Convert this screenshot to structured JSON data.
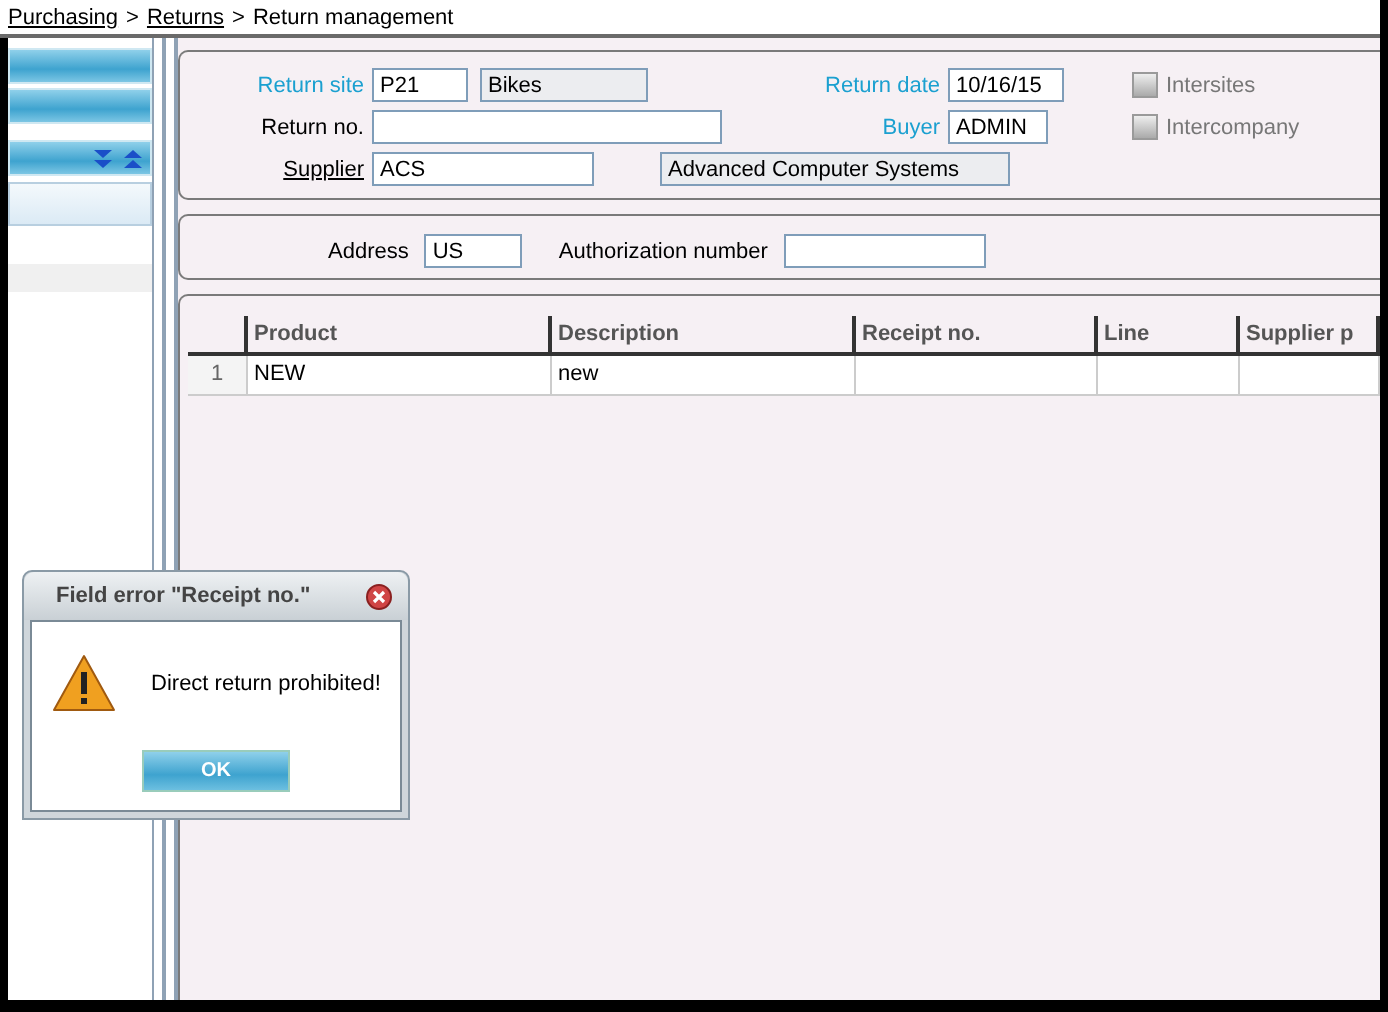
{
  "breadcrumb": [
    {
      "kind": "link",
      "text": "Purchasing"
    },
    {
      "kind": "separator",
      "text": ">"
    },
    {
      "kind": "link",
      "text": "Returns"
    },
    {
      "kind": "separator",
      "text": ">"
    },
    {
      "kind": "current",
      "text": "Return management"
    }
  ],
  "sidebar": {
    "bars": [
      {
        "kind": "plain"
      },
      {
        "kind": "plain"
      },
      {
        "kind": "tools"
      }
    ],
    "items": [
      {
        "selected": true
      },
      {
        "selected": false
      }
    ]
  },
  "header": {
    "rows": [
      {
        "label": {
          "text": "Return site",
          "kind": "required"
        },
        "fields": [
          {
            "value": "P21",
            "readonly": false
          },
          {
            "value": "Bikes",
            "readonly": true
          }
        ],
        "right": {
          "label": {
            "text": "Return date",
            "kind": "required"
          },
          "field": {
            "value": "10/16/15",
            "readonly": false
          }
        },
        "checkbox": {
          "label": "Intersites",
          "checked": false,
          "disabled": true
        }
      },
      {
        "label": {
          "text": "Return no.",
          "kind": "plain"
        },
        "fields": [
          {
            "readonly": false
          }
        ],
        "right": {
          "label": {
            "text": "Buyer",
            "kind": "required"
          },
          "field": {
            "value": "ADMIN",
            "readonly": false
          }
        },
        "checkbox": {
          "label": "Intercompany",
          "checked": false,
          "disabled": true
        }
      },
      {
        "label": {
          "text": "Supplier",
          "kind": "link"
        },
        "fields": [
          {
            "value": "ACS",
            "readonly": false
          },
          {
            "value": "Advanced Computer Systems",
            "readonly": true
          }
        ]
      }
    ]
  },
  "address": {
    "label": "Address",
    "value": "US",
    "authorization": {
      "label": "Authorization number"
    }
  },
  "table": {
    "columns": [
      "Product",
      "Description",
      "Receipt no.",
      "Line",
      "Supplier p"
    ],
    "rows": [
      {
        "number": "1",
        "cells": [
          "NEW",
          "new"
        ]
      }
    ]
  },
  "dialog": {
    "title": "Field error \"Receipt no.\"",
    "message": "Direct return prohibited!",
    "button": "OK"
  }
}
